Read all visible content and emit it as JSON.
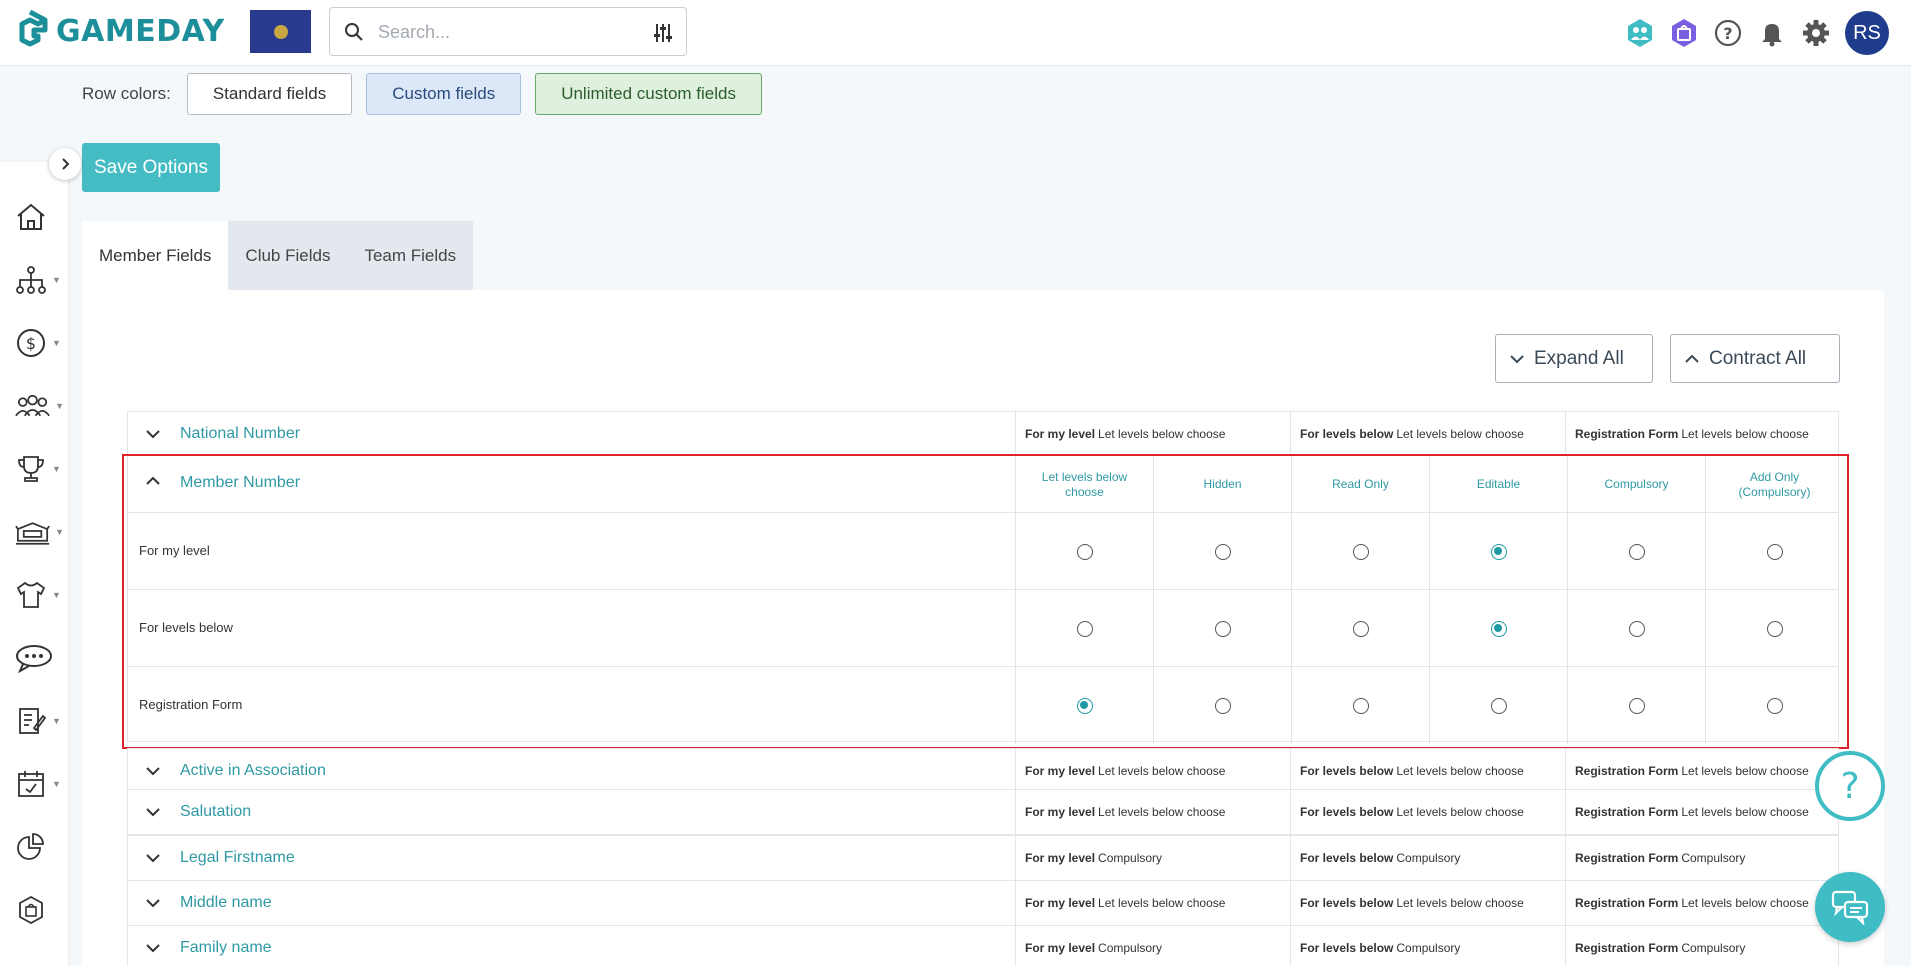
{
  "brand": {
    "name": "GAMEDAY",
    "accent": "#1c8f9a"
  },
  "search": {
    "placeholder": "Search..."
  },
  "user": {
    "initials": "RS"
  },
  "top_icons": [
    "groups-icon",
    "shop-bag-icon",
    "help-circle-icon",
    "bell-icon",
    "gear-icon"
  ],
  "sidebar": {
    "items": [
      "home-icon",
      "hierarchy-icon",
      "dollar-icon",
      "members-icon",
      "trophy-icon",
      "venue-icon",
      "jersey-icon",
      "chat-icon",
      "reports-icon",
      "calendar-icon",
      "pie-chart-icon",
      "bag-icon"
    ]
  },
  "row_colors": {
    "label": "Row colors:",
    "standard": "Standard fields",
    "custom": "Custom fields",
    "unlimited": "Unlimited custom fields"
  },
  "save_label": "Save Options",
  "tabs": [
    "Member Fields",
    "Club Fields",
    "Team Fields"
  ],
  "expand_all": "Expand All",
  "contract_all": "Contract All",
  "labels": {
    "for_my_level": "For my level",
    "for_levels_below": "For levels below",
    "registration_form": "Registration Form"
  },
  "collapsed_rows_top": [
    {
      "name": "National Number",
      "my": "Let levels below choose",
      "below": "Let levels below choose",
      "reg": "Let levels below choose"
    }
  ],
  "expanded_field": {
    "name": "Member Number",
    "columns": [
      "Let levels below choose",
      "Hidden",
      "Read Only",
      "Editable",
      "Compulsory",
      "Add Only (Compulsory)"
    ],
    "rows": [
      {
        "label": "For my level",
        "selected": 3
      },
      {
        "label": "For levels below",
        "selected": 3
      },
      {
        "label": "Registration Form",
        "selected": 0
      }
    ]
  },
  "collapsed_rows_bottom": [
    {
      "name": "Active in Association",
      "my": "Let levels below choose",
      "below": "Let levels below choose",
      "reg": "Let levels below choose"
    },
    {
      "name": "Salutation",
      "my": "Let levels below choose",
      "below": "Let levels below choose",
      "reg": "Let levels below choose"
    },
    {
      "name": "Legal Firstname",
      "my": "Compulsory",
      "below": "Compulsory",
      "reg": "Compulsory"
    },
    {
      "name": "Middle name",
      "my": "Let levels below choose",
      "below": "Let levels below choose",
      "reg": "Let levels below choose"
    },
    {
      "name": "Family name",
      "my": "Compulsory",
      "below": "Compulsory",
      "reg": "Compulsory"
    }
  ]
}
